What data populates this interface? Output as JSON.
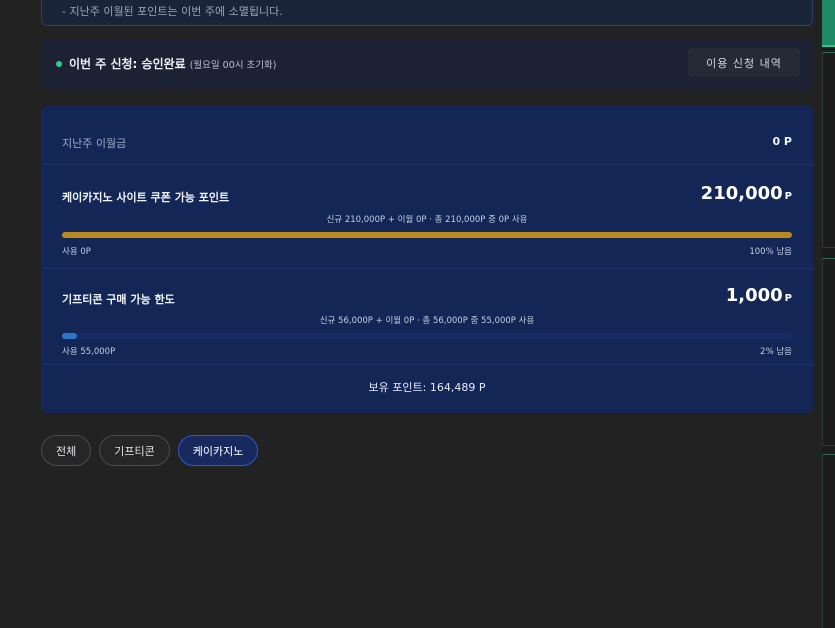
{
  "notice": {
    "text": "- 지난주 이월된 포인트는 이번 주에 소멸됩니다."
  },
  "status": {
    "label": "이번 주 신청: 승인완료",
    "sub": "(월요일 00시 초기화)",
    "history_button": "이용 신청 내역",
    "dot_color": "#2ecc8f"
  },
  "last_week": {
    "label": "지난주 이월금",
    "value": "0 P"
  },
  "casino": {
    "title": "케이카지노 사이트 쿠폰 가능 포인트",
    "value": "210,000",
    "unit": "P",
    "detail": "신규 210,000P + 이월 0P · 총 210,000P 중 0P 사용",
    "used": "사용 0P",
    "remaining": "100% 남음",
    "remaining_fraction": 1.0,
    "bar_color": "#b88a1e"
  },
  "gifticon": {
    "title": "기프티콘 구매 가능 한도",
    "value": "1,000",
    "unit": "P",
    "detail": "신규 56,000P + 이월 0P · 총 56,000P 중 55,000P 사용",
    "used": "사용 55,000P",
    "remaining": "2% 남음",
    "remaining_fraction": 0.02,
    "bar_color": "#2f74c8"
  },
  "balance": "보유 포인트: 164,489 P",
  "filters": {
    "all": "전체",
    "gifticon": "기프티콘",
    "kcasino": "케이카지노",
    "active": "kcasino"
  }
}
